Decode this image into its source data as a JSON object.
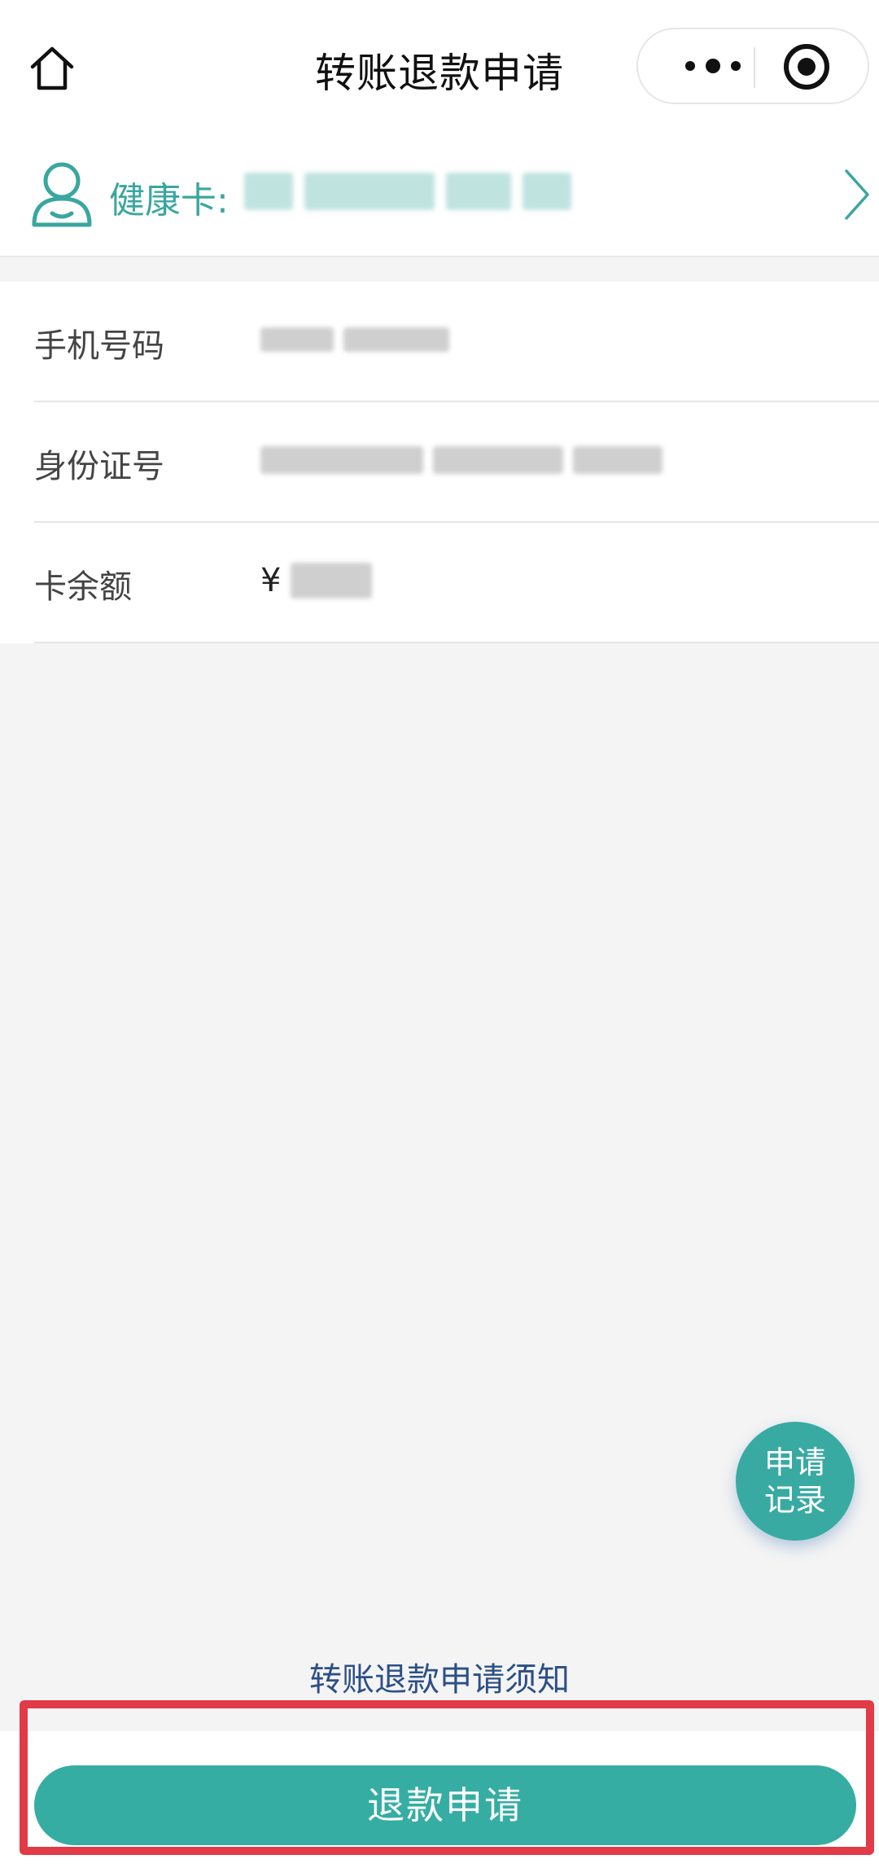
{
  "header": {
    "title": "转账退款申请"
  },
  "card": {
    "label": "健康卡:"
  },
  "info_rows": [
    {
      "label": "手机号码"
    },
    {
      "label": "身份证号"
    },
    {
      "label": "卡余额",
      "currency": "¥"
    }
  ],
  "fab": {
    "line1": "申请",
    "line2": "记录"
  },
  "notice": "转账退款申请须知",
  "submit_label": "退款申请",
  "colors": {
    "accent": "#36ada3",
    "link": "#2c4f86",
    "highlight": "#e23a47"
  },
  "icons": {
    "home": "home-icon",
    "more": "more-dots-icon",
    "close": "target-circle-icon",
    "user": "user-icon",
    "chevron": "chevron-right-icon"
  }
}
